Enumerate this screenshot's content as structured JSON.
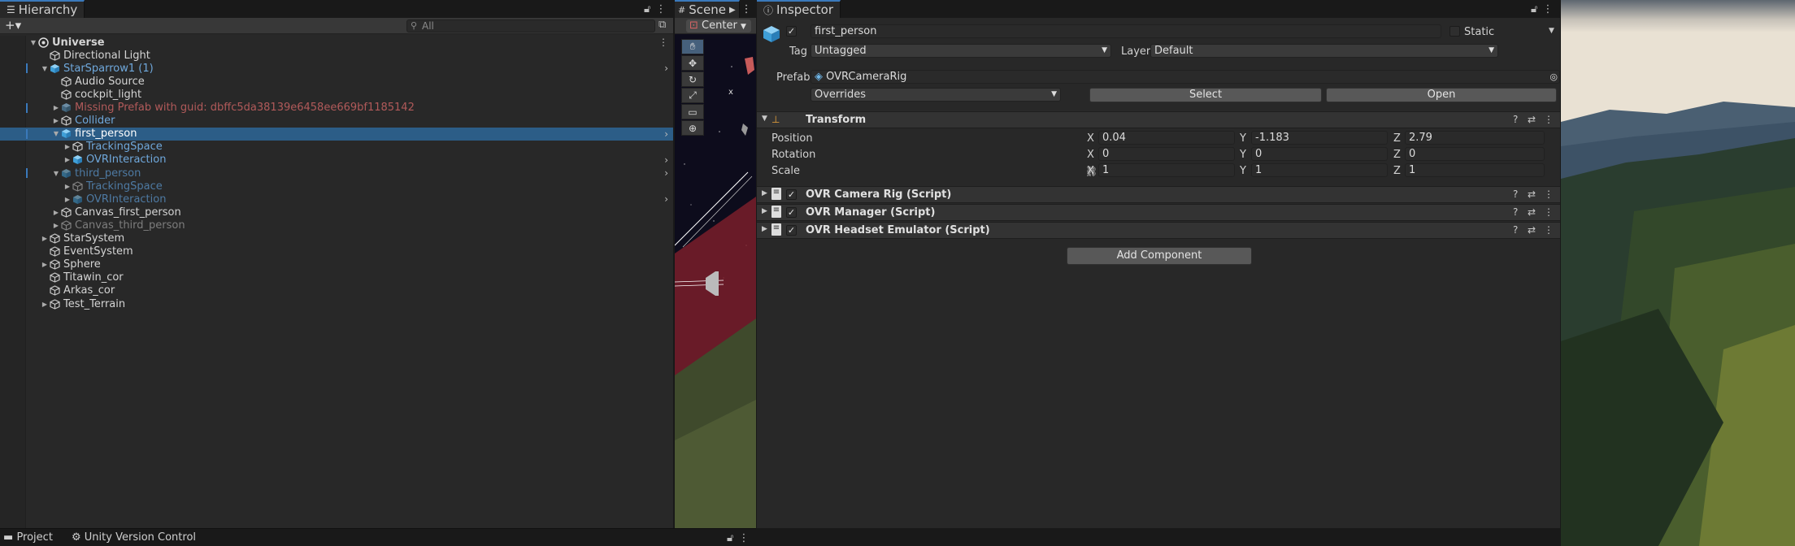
{
  "hierarchy": {
    "tab_label": "Hierarchy",
    "search_placeholder": "All",
    "add_label": "+▾",
    "items": [
      {
        "label": "Universe",
        "depth": 0,
        "fold": "open",
        "icon": "unity-icon",
        "style": "bold"
      },
      {
        "label": "Directional Light",
        "depth": 1,
        "fold": "",
        "icon": "cube-icon",
        "style": ""
      },
      {
        "label": "StarSparrow1 (1)",
        "depth": 1,
        "fold": "open",
        "icon": "prefab-icon",
        "style": "blue"
      },
      {
        "label": "Audio Source",
        "depth": 2,
        "fold": "",
        "icon": "cube-icon",
        "style": ""
      },
      {
        "label": "cockpit_light",
        "depth": 2,
        "fold": "",
        "icon": "cube-icon",
        "style": ""
      },
      {
        "label": "Missing Prefab with guid: dbffc5da38139e6458ee669bf1185142",
        "depth": 2,
        "fold": "closed",
        "icon": "prefab-missing-icon",
        "style": "red"
      },
      {
        "label": "Collider",
        "depth": 2,
        "fold": "closed",
        "icon": "cube-icon",
        "style": "blue"
      },
      {
        "label": "first_person",
        "depth": 2,
        "fold": "open",
        "icon": "prefab-icon",
        "style": "sel"
      },
      {
        "label": "TrackingSpace",
        "depth": 3,
        "fold": "closed",
        "icon": "cube-icon",
        "style": "blue"
      },
      {
        "label": "OVRInteraction",
        "depth": 3,
        "fold": "closed",
        "icon": "prefab-icon",
        "style": "blue"
      },
      {
        "label": "third_person",
        "depth": 2,
        "fold": "open",
        "icon": "prefab-icon",
        "style": "blue-dim"
      },
      {
        "label": "TrackingSpace",
        "depth": 3,
        "fold": "closed",
        "icon": "cube-icon",
        "style": "blue-dim"
      },
      {
        "label": "OVRInteraction",
        "depth": 3,
        "fold": "closed",
        "icon": "prefab-icon",
        "style": "blue-dim"
      },
      {
        "label": "Canvas_first_person",
        "depth": 2,
        "fold": "closed",
        "icon": "cube-icon",
        "style": ""
      },
      {
        "label": "Canvas_third_person",
        "depth": 2,
        "fold": "closed",
        "icon": "cube-icon",
        "style": "dim"
      },
      {
        "label": "StarSystem",
        "depth": 1,
        "fold": "closed",
        "icon": "cube-icon",
        "style": ""
      },
      {
        "label": "EventSystem",
        "depth": 1,
        "fold": "",
        "icon": "cube-icon",
        "style": ""
      },
      {
        "label": "Sphere",
        "depth": 1,
        "fold": "closed",
        "icon": "cube-icon",
        "style": ""
      },
      {
        "label": "Titawin_cor",
        "depth": 1,
        "fold": "",
        "icon": "cube-icon",
        "style": ""
      },
      {
        "label": "Arkas_cor",
        "depth": 1,
        "fold": "",
        "icon": "cube-icon",
        "style": ""
      },
      {
        "label": "Test_Terrain",
        "depth": 1,
        "fold": "closed",
        "icon": "cube-icon",
        "style": ""
      }
    ]
  },
  "scene": {
    "tab_label": "Scene",
    "pivot_label": "Center",
    "tools": [
      "hand-icon",
      "move-icon",
      "rotate-icon",
      "scale-icon",
      "rect-icon",
      "transform-icon"
    ]
  },
  "inspector": {
    "tab_label": "Inspector",
    "object_name": "first_person",
    "static_label": "Static",
    "tag_label": "Tag",
    "tag_value": "Untagged",
    "layer_label": "Layer",
    "layer_value": "Default",
    "prefab_label": "Prefab",
    "prefab_value": "OVRCameraRig",
    "overrides_label": "Overrides",
    "select_label": "Select",
    "open_label": "Open",
    "transform": {
      "title": "Transform",
      "position_label": "Position",
      "rotation_label": "Rotation",
      "scale_label": "Scale",
      "position": {
        "x": "0.04",
        "y": "-1.183",
        "z": "2.79"
      },
      "rotation": {
        "x": "0",
        "y": "0",
        "z": "0"
      },
      "scale": {
        "x": "1",
        "y": "1",
        "z": "1"
      }
    },
    "components": [
      {
        "title": "OVR Camera Rig (Script)"
      },
      {
        "title": "OVR Manager (Script)"
      },
      {
        "title": "OVR Headset Emulator (Script)"
      }
    ],
    "add_component_label": "Add Component"
  },
  "bottom": {
    "project_label": "Project",
    "vcs_label": "Unity Version Control"
  },
  "colors": {
    "accent": "#3a79bb",
    "selection": "#2c5d87",
    "prefab_blue": "#6fa8dc",
    "missing_red": "#b15a5a"
  }
}
